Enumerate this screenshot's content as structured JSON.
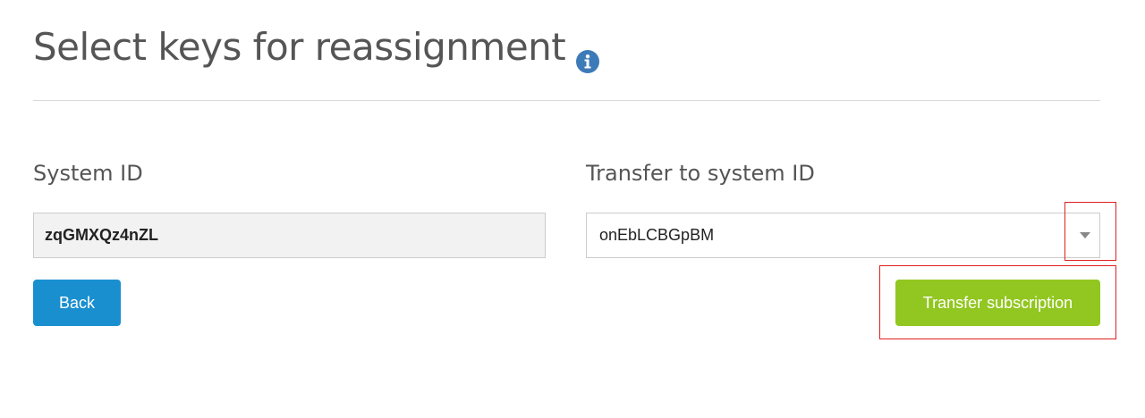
{
  "header": {
    "title": "Select keys for reassignment",
    "info_icon": "info-circle-icon",
    "info_icon_color": "#3d7ab8"
  },
  "form": {
    "source_label": "System ID",
    "source_value": "zqGMXQz4nZL",
    "target_label": "Transfer to system ID",
    "target_selected": "onEbLCBGpBM"
  },
  "actions": {
    "back_label": "Back",
    "back_color": "#1a8fd0",
    "transfer_label": "Transfer subscription",
    "transfer_color": "#92c620"
  },
  "highlights": {
    "color": "#e02020"
  }
}
